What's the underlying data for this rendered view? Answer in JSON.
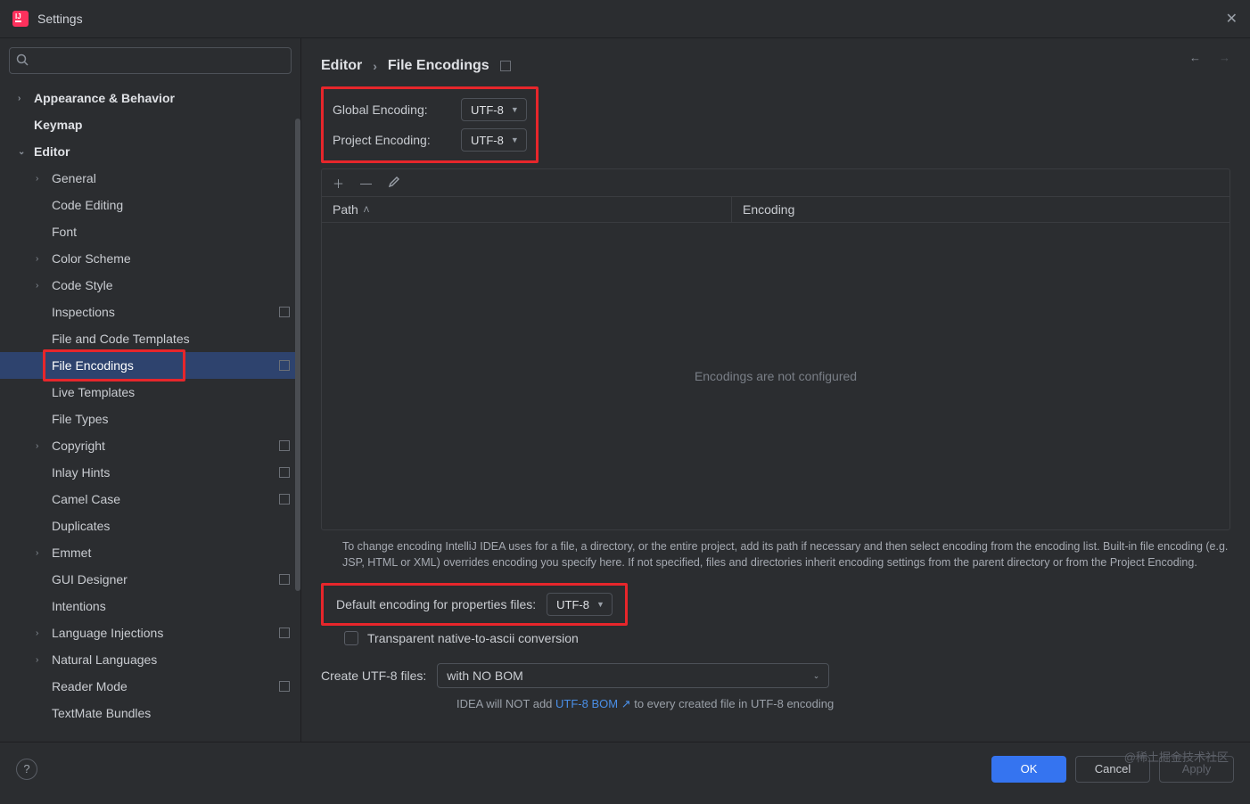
{
  "window": {
    "title": "Settings"
  },
  "breadcrumb": {
    "parent": "Editor",
    "current": "File Encodings"
  },
  "sidebar": {
    "items": [
      {
        "label": "Appearance & Behavior",
        "bold": true,
        "arrow": ">",
        "depth": 0
      },
      {
        "label": "Keymap",
        "bold": true,
        "arrow": "",
        "depth": 0
      },
      {
        "label": "Editor",
        "bold": true,
        "arrow": "v",
        "depth": 0
      },
      {
        "label": "General",
        "bold": false,
        "arrow": ">",
        "depth": 1
      },
      {
        "label": "Code Editing",
        "bold": false,
        "arrow": "",
        "depth": 1
      },
      {
        "label": "Font",
        "bold": false,
        "arrow": "",
        "depth": 1
      },
      {
        "label": "Color Scheme",
        "bold": false,
        "arrow": ">",
        "depth": 1
      },
      {
        "label": "Code Style",
        "bold": false,
        "arrow": ">",
        "depth": 1
      },
      {
        "label": "Inspections",
        "bold": false,
        "arrow": "",
        "depth": 1,
        "marker": true
      },
      {
        "label": "File and Code Templates",
        "bold": false,
        "arrow": "",
        "depth": 1
      },
      {
        "label": "File Encodings",
        "bold": false,
        "arrow": "",
        "depth": 1,
        "selected": true,
        "marker": true,
        "redbox": true
      },
      {
        "label": "Live Templates",
        "bold": false,
        "arrow": "",
        "depth": 1
      },
      {
        "label": "File Types",
        "bold": false,
        "arrow": "",
        "depth": 1
      },
      {
        "label": "Copyright",
        "bold": false,
        "arrow": ">",
        "depth": 1,
        "marker": true
      },
      {
        "label": "Inlay Hints",
        "bold": false,
        "arrow": "",
        "depth": 1,
        "marker": true
      },
      {
        "label": "Camel Case",
        "bold": false,
        "arrow": "",
        "depth": 1,
        "marker": true
      },
      {
        "label": "Duplicates",
        "bold": false,
        "arrow": "",
        "depth": 1
      },
      {
        "label": "Emmet",
        "bold": false,
        "arrow": ">",
        "depth": 1
      },
      {
        "label": "GUI Designer",
        "bold": false,
        "arrow": "",
        "depth": 1,
        "marker": true
      },
      {
        "label": "Intentions",
        "bold": false,
        "arrow": "",
        "depth": 1
      },
      {
        "label": "Language Injections",
        "bold": false,
        "arrow": ">",
        "depth": 1,
        "marker": true
      },
      {
        "label": "Natural Languages",
        "bold": false,
        "arrow": ">",
        "depth": 1
      },
      {
        "label": "Reader Mode",
        "bold": false,
        "arrow": "",
        "depth": 1,
        "marker": true
      },
      {
        "label": "TextMate Bundles",
        "bold": false,
        "arrow": "",
        "depth": 1
      }
    ]
  },
  "encoding": {
    "global_label": "Global Encoding:",
    "global_value": "UTF-8",
    "project_label": "Project Encoding:",
    "project_value": "UTF-8"
  },
  "table": {
    "col_path": "Path",
    "col_encoding": "Encoding",
    "empty": "Encodings are not configured"
  },
  "help_text": "To change encoding IntelliJ IDEA uses for a file, a directory, or the entire project, add its path if necessary and then select encoding from the encoding list. Built-in file encoding (e.g. JSP, HTML or XML) overrides encoding you specify here. If not specified, files and directories inherit encoding settings from the parent directory or from the Project Encoding.",
  "properties": {
    "label": "Default encoding for properties files:",
    "value": "UTF-8",
    "transparent_label": "Transparent native-to-ascii conversion"
  },
  "create": {
    "label": "Create UTF-8 files:",
    "value": "with NO BOM",
    "hint_pre": "IDEA will NOT add ",
    "hint_link": "UTF-8 BOM ↗",
    "hint_post": " to every created file in UTF-8 encoding"
  },
  "footer": {
    "ok": "OK",
    "cancel": "Cancel",
    "apply": "Apply"
  },
  "watermark": "@稀土掘金技术社区"
}
